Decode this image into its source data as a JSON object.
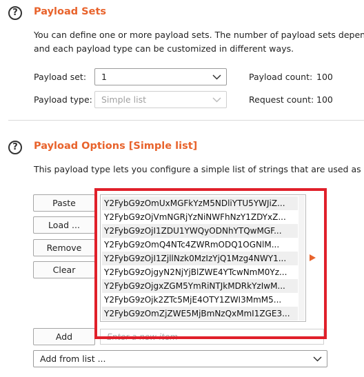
{
  "payload_sets": {
    "title": "Payload Sets",
    "desc_line1": "You can define one or more payload sets. The number of payload sets depends",
    "desc_line2": "and each payload type can be customized in different ways.",
    "payload_set_label": "Payload set:",
    "payload_set_value": "1",
    "payload_type_label": "Payload type:",
    "payload_type_value": "Simple list",
    "payload_count_label": "Payload count:",
    "payload_count_value": "100",
    "request_count_label": "Request count:",
    "request_count_value": "100"
  },
  "payload_options": {
    "title": "Payload Options [Simple list]",
    "desc": "This payload type lets you configure a simple list of strings that are used as pay",
    "buttons": {
      "paste": "Paste",
      "load": "Load ...",
      "remove": "Remove",
      "clear": "Clear",
      "add": "Add"
    },
    "items": [
      "Y2FybG9zOmUxMGFkYzM5NDliYTU5YWJiZ...",
      "Y2FybG9zOjVmNGRjYzNiNWFhNzY1ZDYxZ...",
      "Y2FybG9zOjI1ZDU1YWQyODNhYTQwMGF...",
      "Y2FybG9zOmQ4NTc4ZWRmODQ1OGNlM...",
      "Y2FybG9zOjI1ZjllNzk0MzIzYjQ1Mzg4NWY1...",
      "Y2FybG9zOjgyN2NjYjBlZWE4YTcwNmM0Yz...",
      "Y2FybG9zOjgxZGM5YmRiNTJkMDRkYzIwM...",
      "Y2FybG9zOjk2ZTc5MjE4OTY1ZWI3MmM5...",
      "Y2FybG9zOmZjZWE5MjBmNzQxMmI1ZGE3..."
    ],
    "new_item_placeholder": "Enter a new item",
    "add_from_list": "Add from list ..."
  },
  "colors": {
    "accent": "#e8632c",
    "highlight": "#e0202a"
  }
}
